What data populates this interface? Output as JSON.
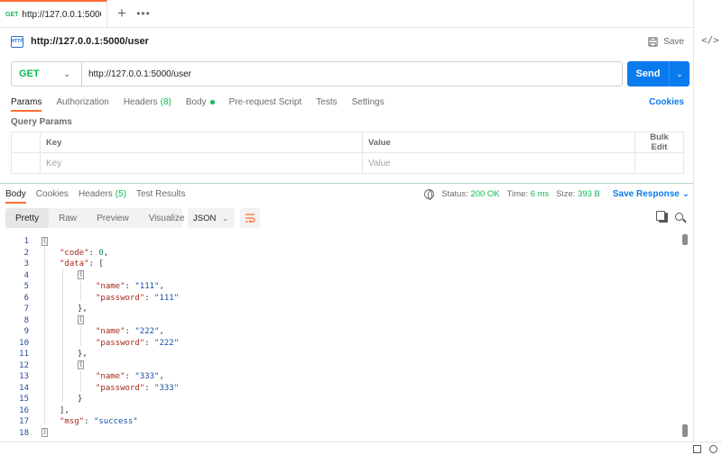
{
  "tab": {
    "method": "GET",
    "title": "http://127.0.0.1:5000/user"
  },
  "request": {
    "name": "http://127.0.0.1:5000/user",
    "save_label": "Save",
    "method": "GET",
    "url": "http://127.0.0.1:5000/user",
    "send_label": "Send"
  },
  "request_tabs": {
    "params": "Params",
    "authorization": "Authorization",
    "headers": "Headers",
    "headers_count": "(8)",
    "body": "Body",
    "prerequest": "Pre-request Script",
    "tests": "Tests",
    "settings": "Settings",
    "cookies": "Cookies"
  },
  "query_params": {
    "label": "Query Params",
    "col_key": "Key",
    "col_value": "Value",
    "bulk_edit": "Bulk Edit",
    "placeholder_key": "Key",
    "placeholder_value": "Value"
  },
  "response_tabs": {
    "body": "Body",
    "cookies": "Cookies",
    "headers": "Headers",
    "headers_count": "(5)",
    "test_results": "Test Results"
  },
  "response_status": {
    "status_label": "Status:",
    "status_value": "200 OK",
    "time_label": "Time:",
    "time_value": "6 ms",
    "size_label": "Size:",
    "size_value": "393 B",
    "save_response": "Save Response"
  },
  "format": {
    "pretty": "Pretty",
    "raw": "Raw",
    "preview": "Preview",
    "visualize": "Visualize",
    "type": "JSON"
  },
  "response_body": {
    "code": 0,
    "data": [
      {
        "name": "111",
        "password": "111"
      },
      {
        "name": "222",
        "password": "222"
      },
      {
        "name": "333",
        "password": "333"
      }
    ],
    "msg": "success"
  },
  "code_lines": [
    {
      "n": "1"
    },
    {
      "n": "2",
      "key": "\"code\"",
      "num": "0"
    },
    {
      "n": "3",
      "key": "\"data\"",
      "punc": "["
    },
    {
      "n": "4"
    },
    {
      "n": "5",
      "key": "\"name\"",
      "str": "\"111\""
    },
    {
      "n": "6",
      "key": "\"password\"",
      "str": "\"111\""
    },
    {
      "n": "7",
      "punc": "},"
    },
    {
      "n": "8"
    },
    {
      "n": "9",
      "key": "\"name\"",
      "str": "\"222\""
    },
    {
      "n": "10",
      "key": "\"password\"",
      "str": "\"222\""
    },
    {
      "n": "11",
      "punc": "},"
    },
    {
      "n": "12"
    },
    {
      "n": "13",
      "key": "\"name\"",
      "str": "\"333\""
    },
    {
      "n": "14",
      "key": "\"password\"",
      "str": "\"333\""
    },
    {
      "n": "15",
      "punc": "}"
    },
    {
      "n": "16",
      "punc": "],"
    },
    {
      "n": "17",
      "key": "\"msg\"",
      "str": "\"success\""
    },
    {
      "n": "18"
    }
  ],
  "colors": {
    "accent": "#ff6c37",
    "send": "#097bed",
    "get": "#0cbb52",
    "json_key": "#a3291c",
    "json_string": "#1550a4",
    "json_number": "#098658"
  }
}
